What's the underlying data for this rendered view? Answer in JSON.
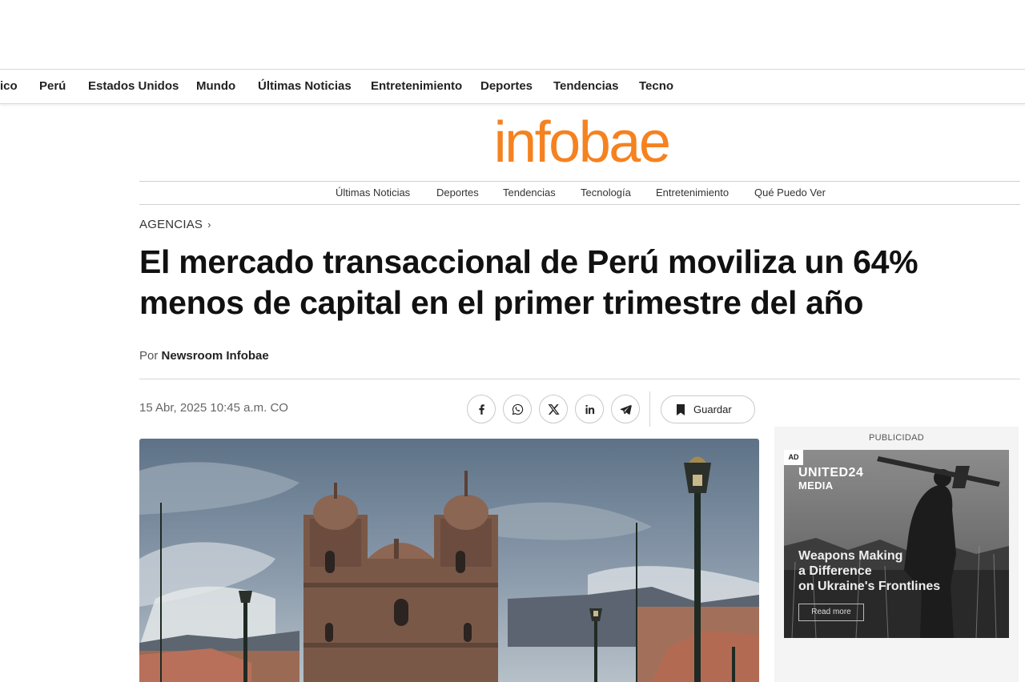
{
  "top_nav": {
    "items": [
      {
        "label": "ico"
      },
      {
        "label": "Perú"
      },
      {
        "label": "Estados Unidos"
      },
      {
        "label": "Mundo"
      },
      {
        "label": "Últimas Noticias"
      },
      {
        "label": "Entretenimiento"
      },
      {
        "label": "Deportes"
      },
      {
        "label": "Tendencias"
      },
      {
        "label": "Tecno"
      }
    ]
  },
  "logo": {
    "text": "infobae",
    "color": "#f58220"
  },
  "sub_nav": {
    "items": [
      {
        "label": "Últimas Noticias"
      },
      {
        "label": "Deportes"
      },
      {
        "label": "Tendencias"
      },
      {
        "label": "Tecnología"
      },
      {
        "label": "Entretenimiento"
      },
      {
        "label": "Qué Puedo Ver"
      }
    ]
  },
  "article": {
    "breadcrumb": "AGENCIAS",
    "headline_line1": "El mercado transaccional de Perú moviliza un 64%",
    "headline_line2": "menos de capital en el primer trimestre del año",
    "byline_prefix": "Por",
    "author": "Newsroom Infobae",
    "date": "15 Abr, 2025 10:45 a.m. CO"
  },
  "share": {
    "buttons": [
      {
        "icon": "facebook-icon"
      },
      {
        "icon": "whatsapp-icon"
      },
      {
        "icon": "x-icon"
      },
      {
        "icon": "linkedin-icon"
      },
      {
        "icon": "telegram-icon"
      }
    ],
    "save_label": "Guardar"
  },
  "sidebar_ad": {
    "label": "PUBLICIDAD",
    "tag": "AD",
    "brand_line1": "UNITED24",
    "brand_line2": "MEDIA",
    "headline": [
      "Weapons Making",
      "a Difference",
      "on Ukraine's Frontlines"
    ],
    "cta": "Read more"
  }
}
